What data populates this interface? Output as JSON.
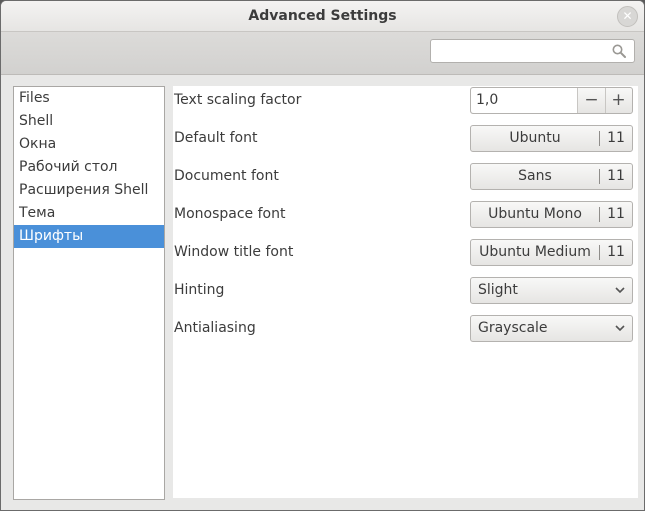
{
  "window": {
    "title": "Advanced Settings",
    "close_glyph": "✕"
  },
  "search": {
    "value": "",
    "placeholder": ""
  },
  "sidebar": {
    "items": [
      {
        "label": "Files"
      },
      {
        "label": "Shell"
      },
      {
        "label": "Окна"
      },
      {
        "label": "Рабочий стол"
      },
      {
        "label": "Расширения Shell"
      },
      {
        "label": "Тема"
      },
      {
        "label": "Шрифты",
        "selected": true
      }
    ]
  },
  "settings": {
    "text_scaling": {
      "label": "Text scaling factor",
      "value": "1,0",
      "minus": "−",
      "plus": "+"
    },
    "default_font": {
      "label": "Default font",
      "name": "Ubuntu",
      "size": "11"
    },
    "document_font": {
      "label": "Document font",
      "name": "Sans",
      "size": "11"
    },
    "monospace_font": {
      "label": "Monospace font",
      "name": "Ubuntu Mono",
      "size": "11"
    },
    "window_title_font": {
      "label": "Window title font",
      "name": "Ubuntu Medium",
      "size": "11"
    },
    "hinting": {
      "label": "Hinting",
      "value": "Slight"
    },
    "antialiasing": {
      "label": "Antialiasing",
      "value": "Grayscale"
    }
  },
  "colors": {
    "selection": "#4a90d9",
    "window_bg": "#e8e8e7",
    "text": "#3c3c3c"
  },
  "icons": [
    "close-icon",
    "search-icon",
    "minus-icon",
    "plus-icon",
    "chevron-down-icon"
  ]
}
